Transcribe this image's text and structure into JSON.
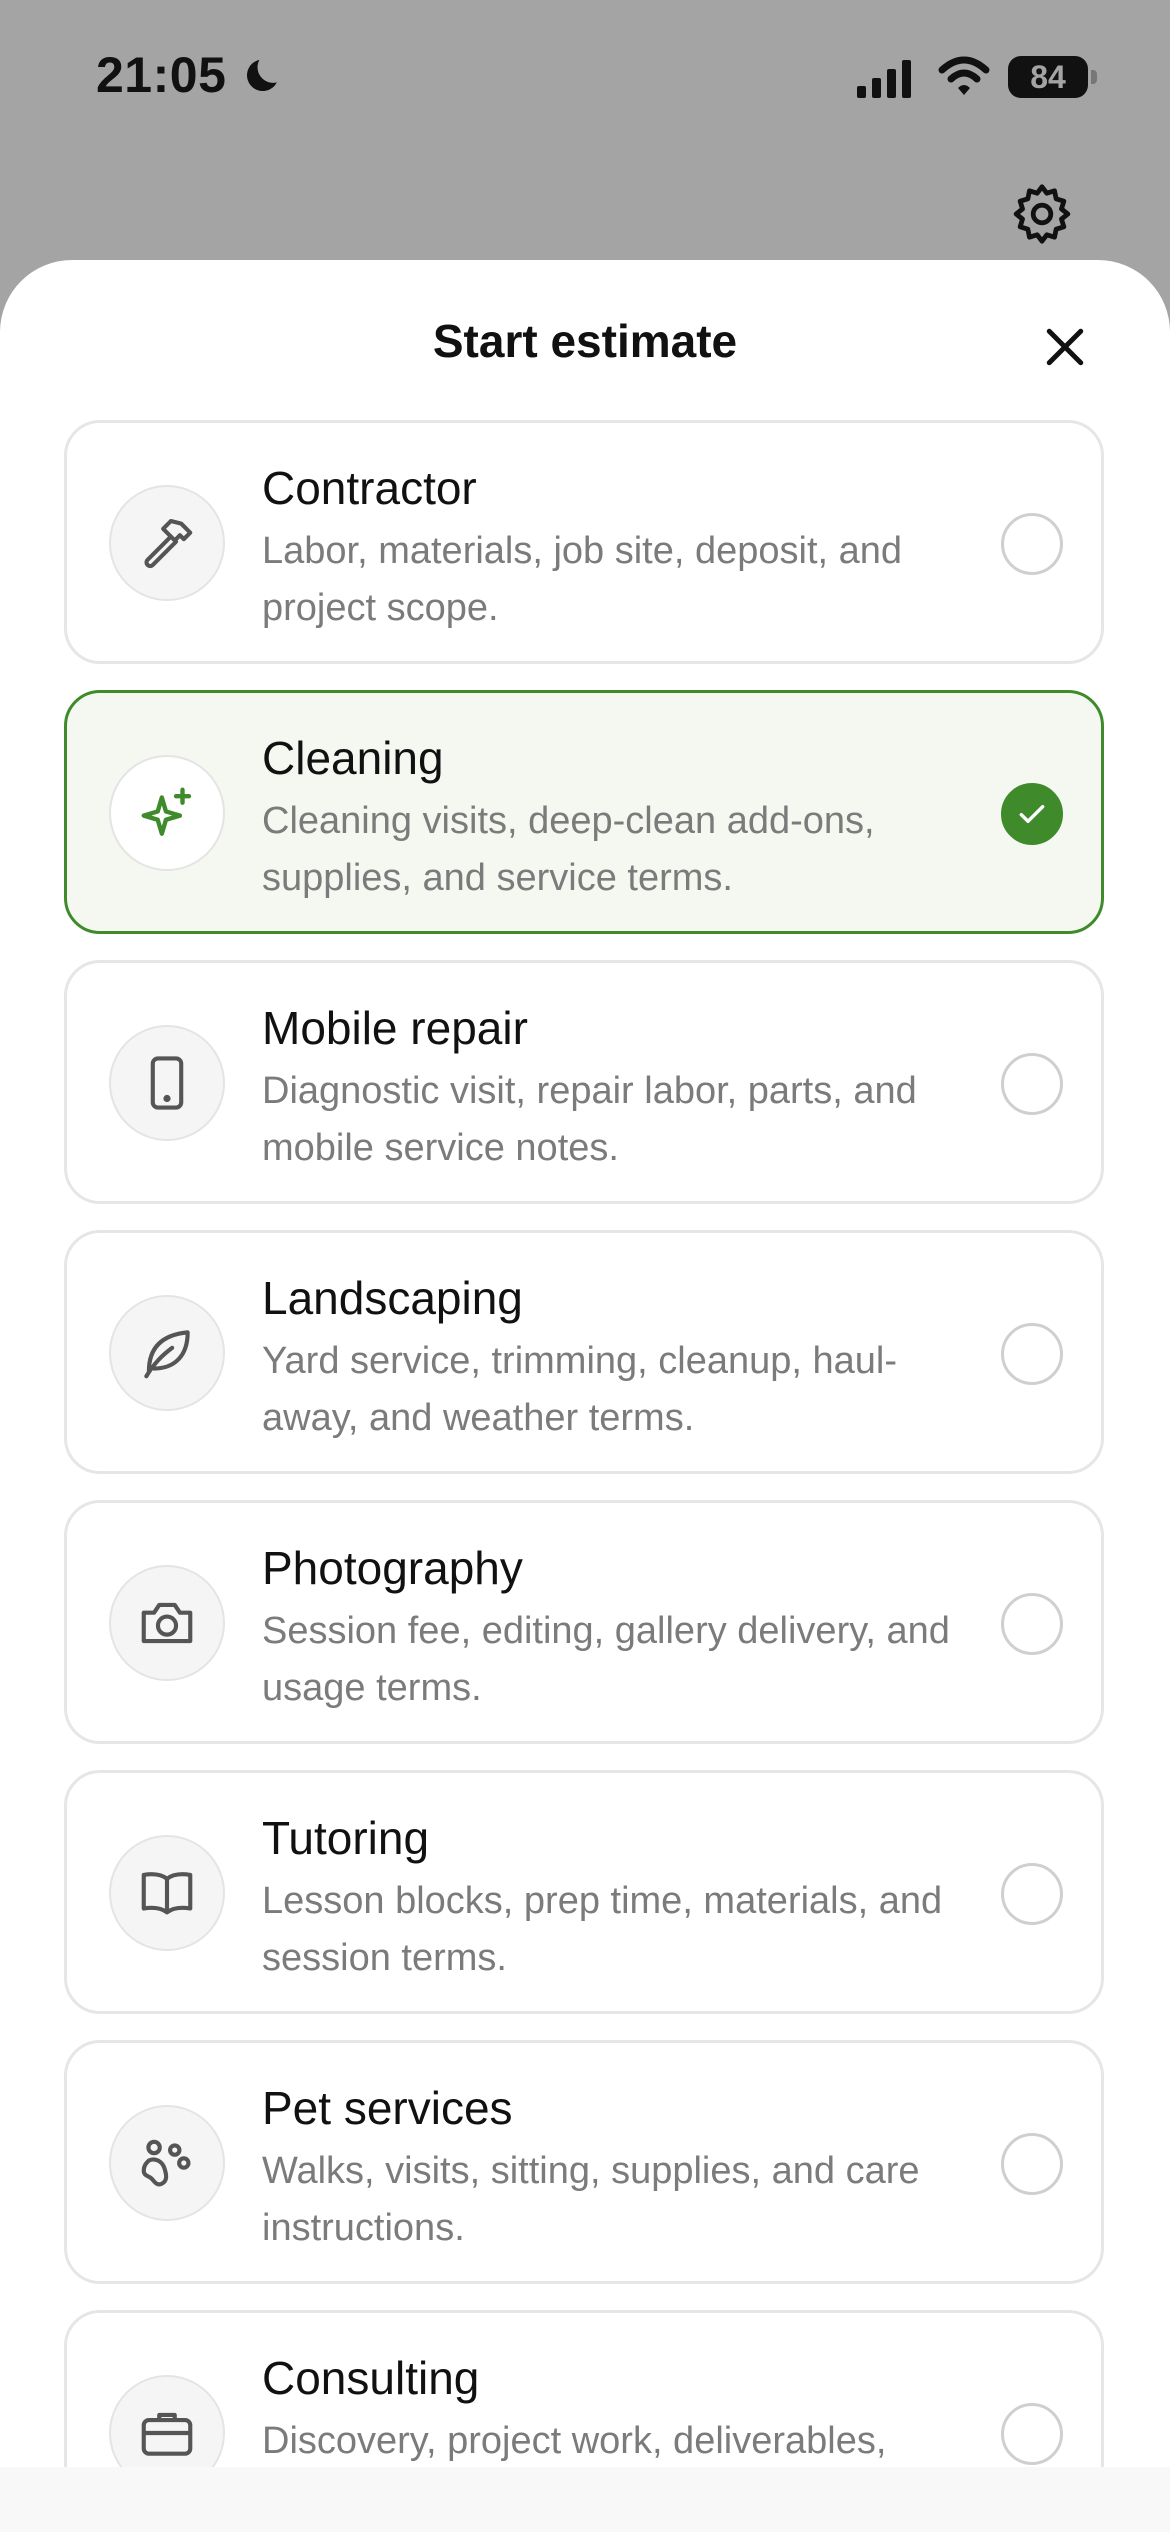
{
  "status_bar": {
    "time": "21:05",
    "battery": "84"
  },
  "sheet": {
    "title": "Start estimate"
  },
  "colors": {
    "accent": "#3f8a2b",
    "selected_bg": "#f5f8f1",
    "overlay": "#a4a4a4"
  },
  "options": [
    {
      "title": "Contractor",
      "description": "Labor, materials, job site, deposit, and project scope.",
      "icon": "hammer-icon",
      "selected": false
    },
    {
      "title": "Cleaning",
      "description": "Cleaning visits, deep-clean add-ons, supplies, and service terms.",
      "icon": "sparkles-icon",
      "selected": true
    },
    {
      "title": "Mobile repair",
      "description": "Diagnostic visit, repair labor, parts, and mobile service notes.",
      "icon": "phone-icon",
      "selected": false
    },
    {
      "title": "Landscaping",
      "description": "Yard service, trimming, cleanup, haul-away, and weather terms.",
      "icon": "leaf-icon",
      "selected": false
    },
    {
      "title": "Photography",
      "description": "Session fee, editing, gallery delivery, and usage terms.",
      "icon": "camera-icon",
      "selected": false
    },
    {
      "title": "Tutoring",
      "description": "Lesson blocks, prep time, materials, and session terms.",
      "icon": "book-icon",
      "selected": false
    },
    {
      "title": "Pet services",
      "description": "Walks, visits, sitting, supplies, and care instructions.",
      "icon": "paw-icon",
      "selected": false
    },
    {
      "title": "Consulting",
      "description": "Discovery, project work, deliverables,",
      "icon": "briefcase-icon",
      "selected": false
    }
  ]
}
